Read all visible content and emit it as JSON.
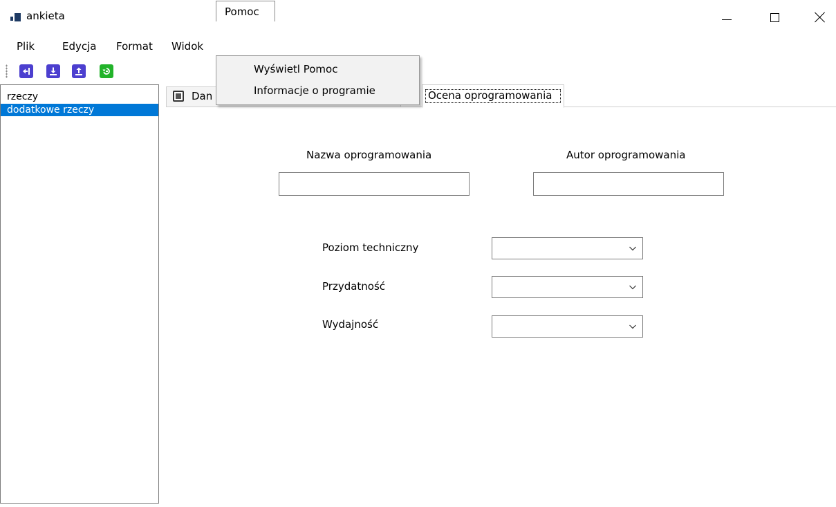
{
  "window": {
    "title": "ankieta",
    "icon": "app-icon",
    "controls": [
      "minimize-icon",
      "maximize-icon",
      "close-icon"
    ]
  },
  "menubar": {
    "items": [
      {
        "label": "Plik"
      },
      {
        "label": "Edycja"
      },
      {
        "label": "Format"
      },
      {
        "label": "Widok"
      },
      {
        "label": "Pomoc",
        "open": true
      }
    ]
  },
  "dropdown": {
    "parent": "Pomoc",
    "items": [
      {
        "label": "Wyświetl Pomoc"
      },
      {
        "label": "Informacje o programie"
      }
    ]
  },
  "toolbar": {
    "buttons": [
      {
        "icon": "import-icon",
        "color": "#4c3fcf"
      },
      {
        "icon": "download-icon",
        "color": "#4c3fcf"
      },
      {
        "icon": "upload-icon",
        "color": "#4c3fcf"
      },
      {
        "icon": "refresh-icon",
        "color": "#22b32a"
      }
    ]
  },
  "listbox": {
    "items": [
      {
        "label": "rzeczy",
        "selected": false
      },
      {
        "label": "dodatkowe rzeczy",
        "selected": true
      }
    ],
    "selection_color": "#0078d7"
  },
  "tabs": [
    {
      "label": "Dan",
      "icon": "form-icon",
      "active": false
    },
    {
      "label": "Ocena oprogramowania",
      "active": true
    }
  ],
  "form": {
    "nazwa_label": "Nazwa oprogramowania",
    "nazwa_value": "",
    "autor_label": "Autor oprogramowania",
    "autor_value": "",
    "combos": [
      {
        "label": "Poziom techniczny",
        "value": ""
      },
      {
        "label": "Przydatność",
        "value": ""
      },
      {
        "label": "Wydajność",
        "value": ""
      }
    ]
  }
}
